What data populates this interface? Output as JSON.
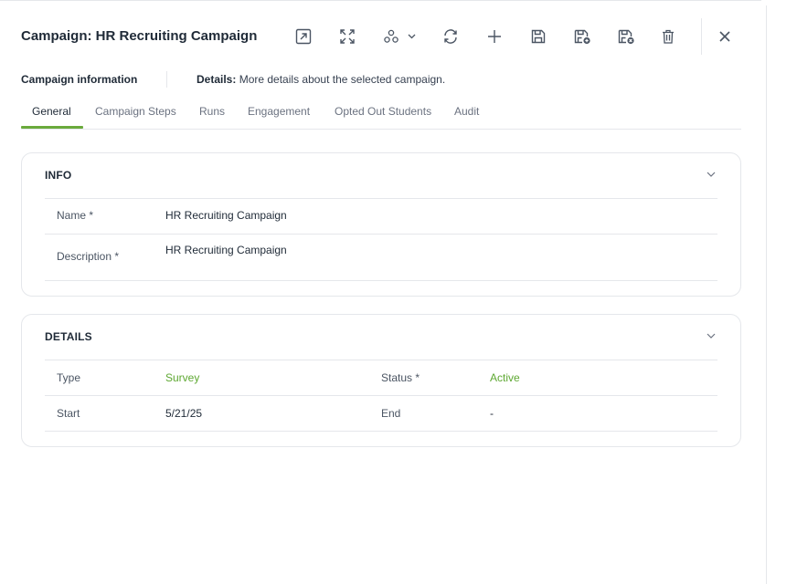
{
  "header": {
    "title": "Campaign: HR Recruiting Campaign",
    "toolbar": [
      {
        "name": "open-external-icon"
      },
      {
        "name": "expand-icon"
      },
      {
        "name": "workflow-dropdown-icon"
      },
      {
        "name": "refresh-icon"
      },
      {
        "name": "add-icon"
      },
      {
        "name": "save-icon"
      },
      {
        "name": "save-and-new-icon"
      },
      {
        "name": "save-and-close-icon"
      },
      {
        "name": "delete-icon"
      },
      {
        "name": "close-icon"
      }
    ]
  },
  "subheader": {
    "section": "Campaign information",
    "details_label": "Details:",
    "details_text": "More details about the selected campaign."
  },
  "tabs": [
    "General",
    "Campaign Steps",
    "Runs",
    "Engagement",
    "Opted Out Students",
    "Audit"
  ],
  "active_tab": "General",
  "info": {
    "title": "INFO",
    "name_label": "Name *",
    "name_value": "HR Recruiting Campaign",
    "description_label": "Description *",
    "description_value": "HR Recruiting Campaign"
  },
  "details": {
    "title": "DETAILS",
    "type_label": "Type",
    "type_value": "Survey",
    "status_label": "Status *",
    "status_value": "Active",
    "start_label": "Start",
    "start_value": "5/21/25",
    "end_label": "End",
    "end_value": "-"
  },
  "colors": {
    "accent": "#6aaa3c",
    "link_green": "#5ea832",
    "text": "#1f2a37",
    "muted": "#6b7280",
    "border": "#e5e7eb"
  }
}
